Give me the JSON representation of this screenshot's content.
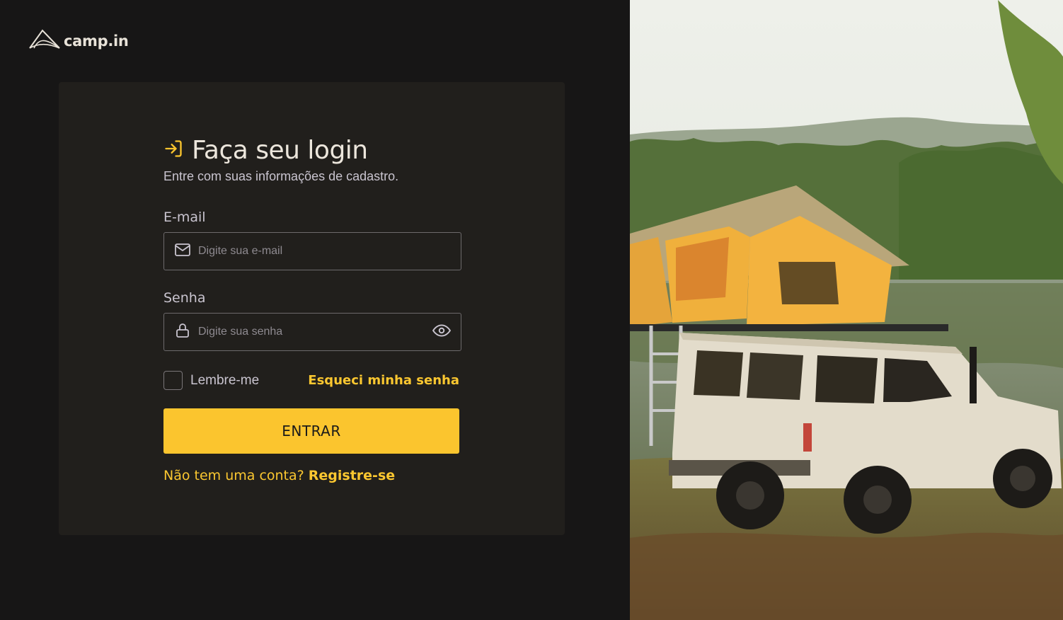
{
  "brand": {
    "name": "camp.in"
  },
  "login": {
    "title": "Faça seu login",
    "subtitle": "Entre com suas informações de cadastro.",
    "email_label": "E-mail",
    "email_placeholder": "Digite sua e-mail",
    "email_value": "",
    "password_label": "Senha",
    "password_placeholder": "Digite sua senha",
    "password_value": "",
    "remember_label": "Lembre-me",
    "remember_checked": false,
    "forgot_label": "Esqueci minha senha",
    "submit_label": "ENTRAR",
    "signup_prompt": "Não tem uma conta?",
    "signup_link": "Registre-se"
  },
  "colors": {
    "accent": "#fbc52e",
    "background": "#171616",
    "card": "#211f1c"
  },
  "icons": {
    "logo": "tent-icon",
    "title": "login-arrow-icon",
    "email": "mail-icon",
    "password": "lock-icon",
    "visibility": "eye-icon"
  }
}
